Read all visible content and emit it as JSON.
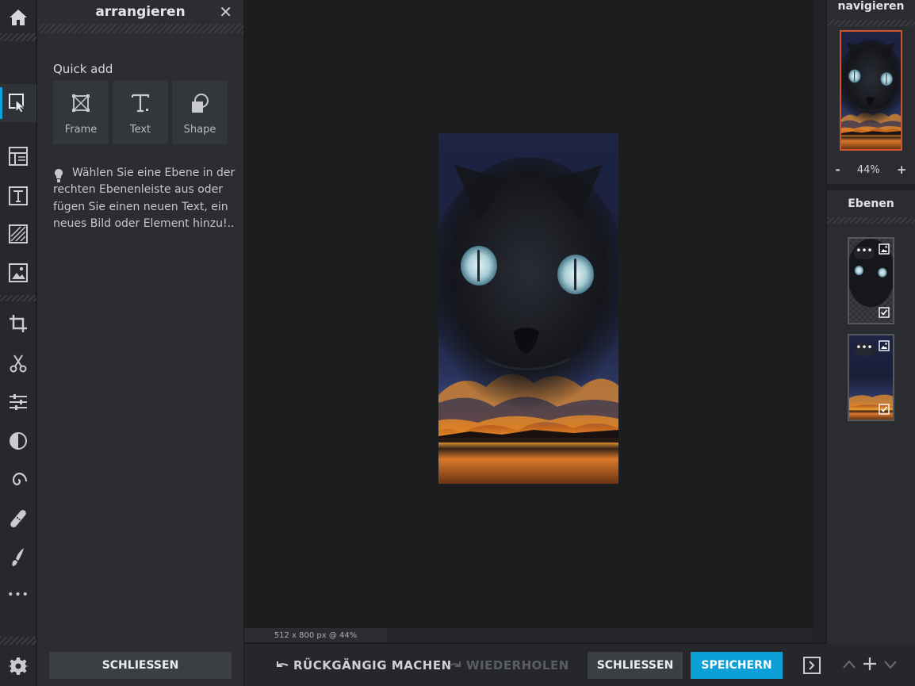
{
  "toolbar": {
    "tools": [
      {
        "name": "home-icon",
        "active": false
      },
      {
        "name": "arrange-icon",
        "active": true
      },
      {
        "name": "layout-icon",
        "active": false
      },
      {
        "name": "text-tool-icon",
        "active": false
      },
      {
        "name": "texture-icon",
        "active": false
      },
      {
        "name": "image-icon",
        "active": false
      },
      {
        "name": "crop-icon",
        "active": false
      },
      {
        "name": "cut-icon",
        "active": false
      },
      {
        "name": "adjust-icon",
        "active": false
      },
      {
        "name": "contrast-icon",
        "active": false
      },
      {
        "name": "spiral-icon",
        "active": false
      },
      {
        "name": "bandage-icon",
        "active": false
      },
      {
        "name": "brush-icon",
        "active": false
      },
      {
        "name": "more-icon",
        "active": false
      },
      {
        "name": "gear-icon",
        "active": false
      }
    ],
    "more_label": "•••"
  },
  "panel": {
    "title": "arrangieren",
    "close_symbol": "✕",
    "quick_add_label": "Quick add",
    "quick_add": [
      {
        "label": "Frame",
        "icon": "frame-icon"
      },
      {
        "label": "Text",
        "icon": "text-icon"
      },
      {
        "label": "Shape",
        "icon": "shape-icon"
      }
    ],
    "hint": "Wählen Sie eine Ebene in der rechten Ebenenleiste aus oder fügen Sie einen neuen Text, ein neues Bild oder Element hinzu!..",
    "close_button": "SCHLIESSEN"
  },
  "canvas": {
    "status": "512 x 800 px @ 44%"
  },
  "bottom": {
    "undo": "RÜCKGÄNGIG MACHEN",
    "redo": "WIEDERHOLEN",
    "close": "SCHLIESSEN",
    "save": "SPEICHERN"
  },
  "navigator": {
    "title": "navigieren",
    "zoom_minus": "-",
    "zoom": "44%",
    "zoom_plus": "+"
  },
  "layers": {
    "title": "Ebenen",
    "items": [
      {
        "name": "cat-layer",
        "dots": "•••"
      },
      {
        "name": "sunset-layer",
        "dots": "•••"
      }
    ]
  },
  "colors": {
    "accent": "#0d9fd8",
    "nav_border": "#d3542a",
    "bg": "#1c1d1f"
  }
}
